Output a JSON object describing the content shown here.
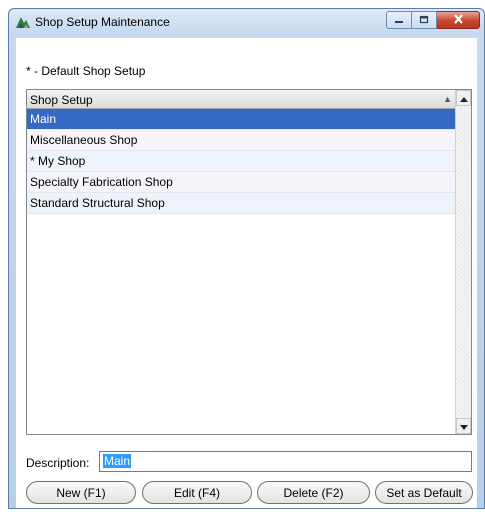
{
  "window": {
    "title": "Shop Setup Maintenance",
    "app_icon": "shop-setup-app-icon",
    "caption_buttons": [
      "minimize-icon",
      "maximize-icon",
      "close-icon"
    ]
  },
  "legend": "* - Default Shop Setup",
  "list": {
    "column_header": "Shop Setup",
    "sort_icon": "sort-ascending-icon",
    "rows": [
      {
        "label": "Main",
        "selected": true
      },
      {
        "label": "Miscellaneous Shop",
        "selected": false
      },
      {
        "label": "* My Shop",
        "selected": false
      },
      {
        "label": "Specialty Fabrication Shop",
        "selected": false
      },
      {
        "label": "Standard Structural Shop",
        "selected": false
      }
    ]
  },
  "description": {
    "label": "Description:",
    "value": "Main"
  },
  "buttons": {
    "new": "New (F1)",
    "edit": "Edit (F4)",
    "delete": "Delete (F2)",
    "set_default": "Set as Default"
  },
  "colors": {
    "selection": "#3569c4",
    "close_button": "#c9452c",
    "titlebar": "#c5d8ee"
  }
}
